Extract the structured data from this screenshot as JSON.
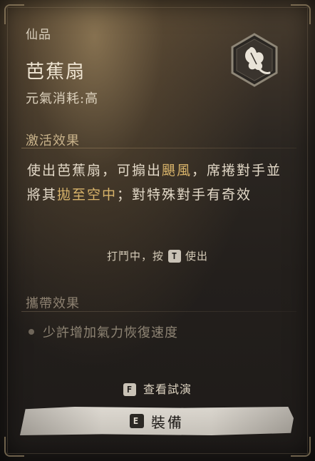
{
  "item": {
    "rarity": "仙品",
    "name": "芭蕉扇",
    "cost": "元氣消耗:高",
    "icon": "fan-leaf-icon"
  },
  "active_effect": {
    "title": "激活效果",
    "description": {
      "part1": "使出芭蕉扇，可搧出",
      "highlight1": "颶風",
      "part2": "，席捲對手並將其",
      "highlight2": "拋至空中",
      "part3": "；對特殊對手有奇效"
    },
    "hint_prefix": "打鬥中，按",
    "hint_key": "T",
    "hint_suffix": "使出"
  },
  "carry_effect": {
    "title": "攜帶效果",
    "items": [
      "少許增加氣力恢復速度"
    ]
  },
  "actions": {
    "preview_key": "F",
    "preview_label": "查看試演",
    "equip_key": "E",
    "equip_label": "裝備"
  },
  "colors": {
    "highlight": "#d8b36a",
    "section_title": "#c8b28a",
    "text": "#e3d9c8",
    "button_bg": "#d6d1c8"
  }
}
